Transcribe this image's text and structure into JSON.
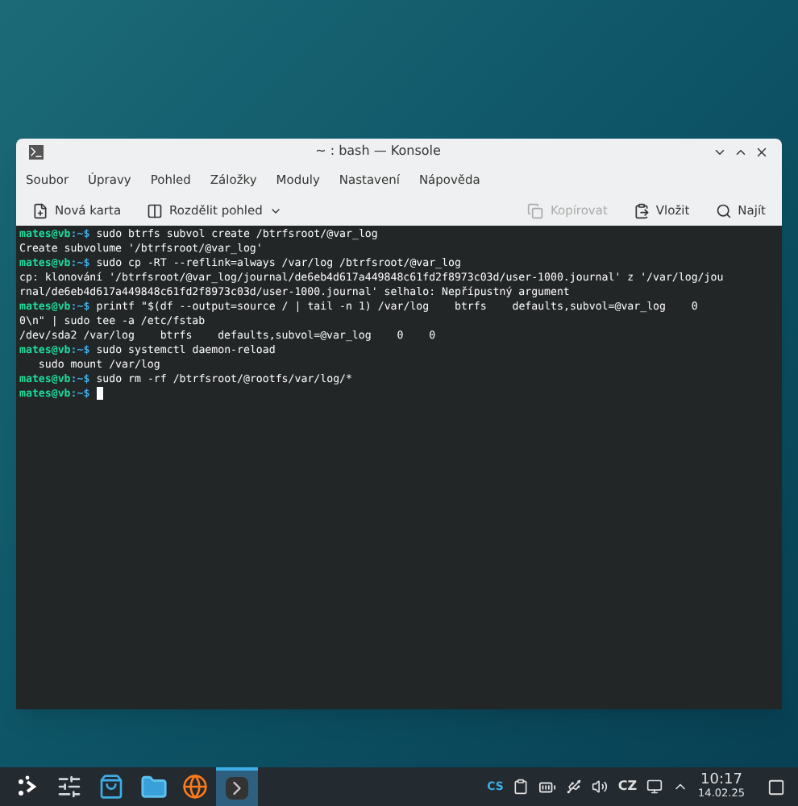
{
  "window": {
    "title": "~ : bash — Konsole"
  },
  "menu": [
    "Soubor",
    "Úpravy",
    "Pohled",
    "Záložky",
    "Moduly",
    "Nastavení",
    "Nápověda"
  ],
  "toolbar": [
    {
      "kind": "new-tab",
      "label": "Nová karta",
      "disabled": false
    },
    {
      "kind": "split",
      "label": "Rozdělit pohled",
      "disabled": false
    },
    {
      "kind": "copy",
      "label": "Kopírovat",
      "disabled": true
    },
    {
      "kind": "paste",
      "label": "Vložit",
      "disabled": false
    },
    {
      "kind": "find",
      "label": "Najít",
      "disabled": false
    }
  ],
  "terminal": {
    "lines": [
      {
        "prompt": "mates@vb:~$",
        "command": "sudo btrfs subvol create /btrfsroot/@var_log"
      },
      {
        "text": "Create subvolume '/btrfsroot/@var_log'"
      },
      {
        "prompt": "mates@vb:~$",
        "command": "sudo cp -RT --reflink=always /var/log /btrfsroot/@var_log"
      },
      {
        "text": "cp: klonování '/btrfsroot/@var_log/journal/de6eb4d617a449848c61fd2f8973c03d/user-1000.journal' z '/var/log/jou"
      },
      {
        "text": "rnal/de6eb4d617a449848c61fd2f8973c03d/user-1000.journal' selhalo: Nepřípustný argument"
      },
      {
        "prompt": "mates@vb:~$",
        "command": "printf \"$(df --output=source / | tail -n 1) /var/log    btrfs    defaults,subvol=@var_log    0"
      },
      {
        "text": "0\\n\" | sudo tee -a /etc/fstab"
      },
      {
        "text": "/dev/sda2 /var/log    btrfs    defaults,subvol=@var_log    0    0"
      },
      {
        "prompt": "mates@vb:~$",
        "command": "sudo systemctl daemon-reload"
      },
      {
        "text": "   sudo mount /var/log"
      },
      {
        "prompt": "mates@vb:~$",
        "command": "sudo rm -rf /btrfsroot/@rootfs/var/log/*"
      },
      {
        "prompt": "mates@vb:~$",
        "cursor": true
      }
    ]
  },
  "taskbar": {
    "apps": [
      {
        "kind": "launcher",
        "selected": false
      },
      {
        "kind": "settings",
        "selected": false
      },
      {
        "kind": "store",
        "selected": false
      },
      {
        "kind": "files",
        "selected": false
      },
      {
        "kind": "browser",
        "selected": false
      },
      {
        "kind": "terminal",
        "selected": true
      }
    ],
    "input_method": "CS",
    "keyboard_layout": "CZ",
    "time": "10:17",
    "date": "14.02.25"
  }
}
